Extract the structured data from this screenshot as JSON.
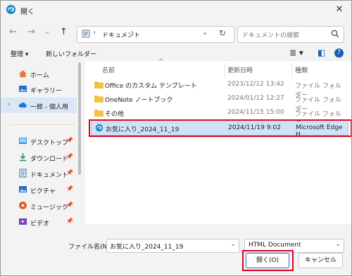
{
  "window": {
    "title": "開く",
    "close_glyph": "✕"
  },
  "nav": {
    "back": "←",
    "forward": "→",
    "recent": "⌄",
    "up": "↑",
    "address": {
      "sep1": "›",
      "crumb": "ドキュメント",
      "sep2": "›",
      "dropdown": "⌄",
      "refresh": "↻"
    },
    "search": {
      "placeholder": "ドキュメントの検索"
    }
  },
  "toolbar": {
    "organize": "整理 ▾",
    "new_folder": "新しいフォルダー",
    "view_glyph": "≣ ▾",
    "pane_glyph": "◧",
    "help_glyph": "?"
  },
  "sidebar": {
    "items": [
      {
        "label": "ホーム",
        "icon": "home-icon"
      },
      {
        "label": "ギャラリー",
        "icon": "gallery-icon"
      },
      {
        "label": "一郎 - 個人用",
        "icon": "cloud-icon",
        "expander": "›"
      },
      {
        "label": "デスクトップ",
        "icon": "desktop-icon"
      },
      {
        "label": "ダウンロード",
        "icon": "download-icon"
      },
      {
        "label": "ドキュメント",
        "icon": "document-icon"
      },
      {
        "label": "ピクチャ",
        "icon": "picture-icon"
      },
      {
        "label": "ミュージック",
        "icon": "music-icon"
      },
      {
        "label": "ビデオ",
        "icon": "video-icon"
      }
    ],
    "pin_glyph": "📌"
  },
  "list": {
    "columns": {
      "name": "名前",
      "date": "更新日時",
      "type": "種類"
    },
    "sort_glyph": "^",
    "rows": [
      {
        "name": "Office のカスタム テンプレート",
        "date": "2023/12/12 13:42",
        "type": "ファイル フォルダー"
      },
      {
        "name": "OneNote ノートブック",
        "date": "2024/01/12 12:27",
        "type": "ファイル フォルダー"
      },
      {
        "name": "その他",
        "date": "2024/11/15 15:00",
        "type": "ファイル フォルダー"
      },
      {
        "name": "お気に入り_2024_11_19",
        "date": "2024/11/19 9:02",
        "type": "Microsoft Edge H..."
      }
    ]
  },
  "bottom": {
    "filename_label": "ファイル名(N):",
    "filename_value": "お気に入り_2024_11_19",
    "filetype_value": "HTML Document",
    "dropdown": "⌄",
    "open_label": "開く(O)",
    "cancel_label": "キャンセル"
  },
  "colors": {
    "highlight": "#e00020",
    "selection": "#cfe3f7",
    "folder": "#f4c242",
    "edge": "#1e88c8"
  }
}
